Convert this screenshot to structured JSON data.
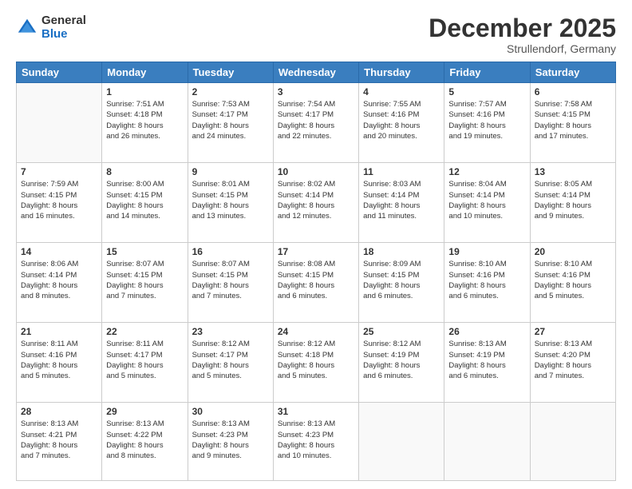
{
  "logo": {
    "general": "General",
    "blue": "Blue"
  },
  "header": {
    "month": "December 2025",
    "location": "Strullendorf, Germany"
  },
  "weekdays": [
    "Sunday",
    "Monday",
    "Tuesday",
    "Wednesday",
    "Thursday",
    "Friday",
    "Saturday"
  ],
  "weeks": [
    [
      {
        "day": "",
        "info": ""
      },
      {
        "day": "1",
        "info": "Sunrise: 7:51 AM\nSunset: 4:18 PM\nDaylight: 8 hours\nand 26 minutes."
      },
      {
        "day": "2",
        "info": "Sunrise: 7:53 AM\nSunset: 4:17 PM\nDaylight: 8 hours\nand 24 minutes."
      },
      {
        "day": "3",
        "info": "Sunrise: 7:54 AM\nSunset: 4:17 PM\nDaylight: 8 hours\nand 22 minutes."
      },
      {
        "day": "4",
        "info": "Sunrise: 7:55 AM\nSunset: 4:16 PM\nDaylight: 8 hours\nand 20 minutes."
      },
      {
        "day": "5",
        "info": "Sunrise: 7:57 AM\nSunset: 4:16 PM\nDaylight: 8 hours\nand 19 minutes."
      },
      {
        "day": "6",
        "info": "Sunrise: 7:58 AM\nSunset: 4:15 PM\nDaylight: 8 hours\nand 17 minutes."
      }
    ],
    [
      {
        "day": "7",
        "info": "Sunrise: 7:59 AM\nSunset: 4:15 PM\nDaylight: 8 hours\nand 16 minutes."
      },
      {
        "day": "8",
        "info": "Sunrise: 8:00 AM\nSunset: 4:15 PM\nDaylight: 8 hours\nand 14 minutes."
      },
      {
        "day": "9",
        "info": "Sunrise: 8:01 AM\nSunset: 4:15 PM\nDaylight: 8 hours\nand 13 minutes."
      },
      {
        "day": "10",
        "info": "Sunrise: 8:02 AM\nSunset: 4:14 PM\nDaylight: 8 hours\nand 12 minutes."
      },
      {
        "day": "11",
        "info": "Sunrise: 8:03 AM\nSunset: 4:14 PM\nDaylight: 8 hours\nand 11 minutes."
      },
      {
        "day": "12",
        "info": "Sunrise: 8:04 AM\nSunset: 4:14 PM\nDaylight: 8 hours\nand 10 minutes."
      },
      {
        "day": "13",
        "info": "Sunrise: 8:05 AM\nSunset: 4:14 PM\nDaylight: 8 hours\nand 9 minutes."
      }
    ],
    [
      {
        "day": "14",
        "info": "Sunrise: 8:06 AM\nSunset: 4:14 PM\nDaylight: 8 hours\nand 8 minutes."
      },
      {
        "day": "15",
        "info": "Sunrise: 8:07 AM\nSunset: 4:15 PM\nDaylight: 8 hours\nand 7 minutes."
      },
      {
        "day": "16",
        "info": "Sunrise: 8:07 AM\nSunset: 4:15 PM\nDaylight: 8 hours\nand 7 minutes."
      },
      {
        "day": "17",
        "info": "Sunrise: 8:08 AM\nSunset: 4:15 PM\nDaylight: 8 hours\nand 6 minutes."
      },
      {
        "day": "18",
        "info": "Sunrise: 8:09 AM\nSunset: 4:15 PM\nDaylight: 8 hours\nand 6 minutes."
      },
      {
        "day": "19",
        "info": "Sunrise: 8:10 AM\nSunset: 4:16 PM\nDaylight: 8 hours\nand 6 minutes."
      },
      {
        "day": "20",
        "info": "Sunrise: 8:10 AM\nSunset: 4:16 PM\nDaylight: 8 hours\nand 5 minutes."
      }
    ],
    [
      {
        "day": "21",
        "info": "Sunrise: 8:11 AM\nSunset: 4:16 PM\nDaylight: 8 hours\nand 5 minutes."
      },
      {
        "day": "22",
        "info": "Sunrise: 8:11 AM\nSunset: 4:17 PM\nDaylight: 8 hours\nand 5 minutes."
      },
      {
        "day": "23",
        "info": "Sunrise: 8:12 AM\nSunset: 4:17 PM\nDaylight: 8 hours\nand 5 minutes."
      },
      {
        "day": "24",
        "info": "Sunrise: 8:12 AM\nSunset: 4:18 PM\nDaylight: 8 hours\nand 5 minutes."
      },
      {
        "day": "25",
        "info": "Sunrise: 8:12 AM\nSunset: 4:19 PM\nDaylight: 8 hours\nand 6 minutes."
      },
      {
        "day": "26",
        "info": "Sunrise: 8:13 AM\nSunset: 4:19 PM\nDaylight: 8 hours\nand 6 minutes."
      },
      {
        "day": "27",
        "info": "Sunrise: 8:13 AM\nSunset: 4:20 PM\nDaylight: 8 hours\nand 7 minutes."
      }
    ],
    [
      {
        "day": "28",
        "info": "Sunrise: 8:13 AM\nSunset: 4:21 PM\nDaylight: 8 hours\nand 7 minutes."
      },
      {
        "day": "29",
        "info": "Sunrise: 8:13 AM\nSunset: 4:22 PM\nDaylight: 8 hours\nand 8 minutes."
      },
      {
        "day": "30",
        "info": "Sunrise: 8:13 AM\nSunset: 4:23 PM\nDaylight: 8 hours\nand 9 minutes."
      },
      {
        "day": "31",
        "info": "Sunrise: 8:13 AM\nSunset: 4:23 PM\nDaylight: 8 hours\nand 10 minutes."
      },
      {
        "day": "",
        "info": ""
      },
      {
        "day": "",
        "info": ""
      },
      {
        "day": "",
        "info": ""
      }
    ]
  ]
}
